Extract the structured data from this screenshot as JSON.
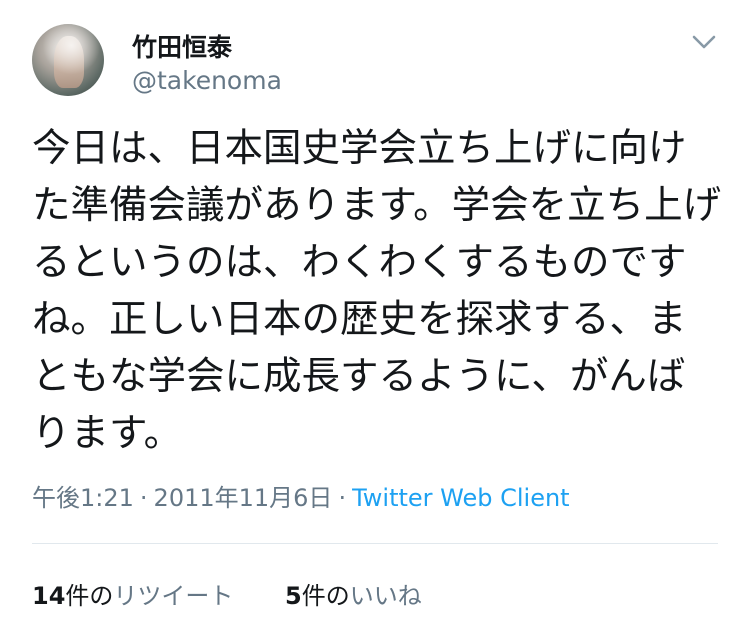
{
  "user": {
    "display_name": "竹田恒泰",
    "handle": "@takenoma"
  },
  "tweet": {
    "text": "今日は、日本国史学会立ち上げに向けた準備会議があります。学会を立ち上げるというのは、わくわくするものですね。正しい日本の歴史を探求する、まともな学会に成長するように、がんばります。"
  },
  "meta": {
    "time": "午後1:21",
    "separator": "·",
    "date": "2011年11月6日",
    "client": "Twitter Web Client"
  },
  "stats": {
    "retweets": {
      "count": "14",
      "unit": "件の",
      "label": "リツイート"
    },
    "likes": {
      "count": "5",
      "unit": "件の",
      "label": "いいね"
    }
  },
  "icons": {
    "menu": "chevron-down-icon",
    "avatar": "profile-photo"
  },
  "colors": {
    "text": "#14171a",
    "secondary": "#657786",
    "link": "#1da1f2",
    "divider": "#e1e8ed"
  }
}
